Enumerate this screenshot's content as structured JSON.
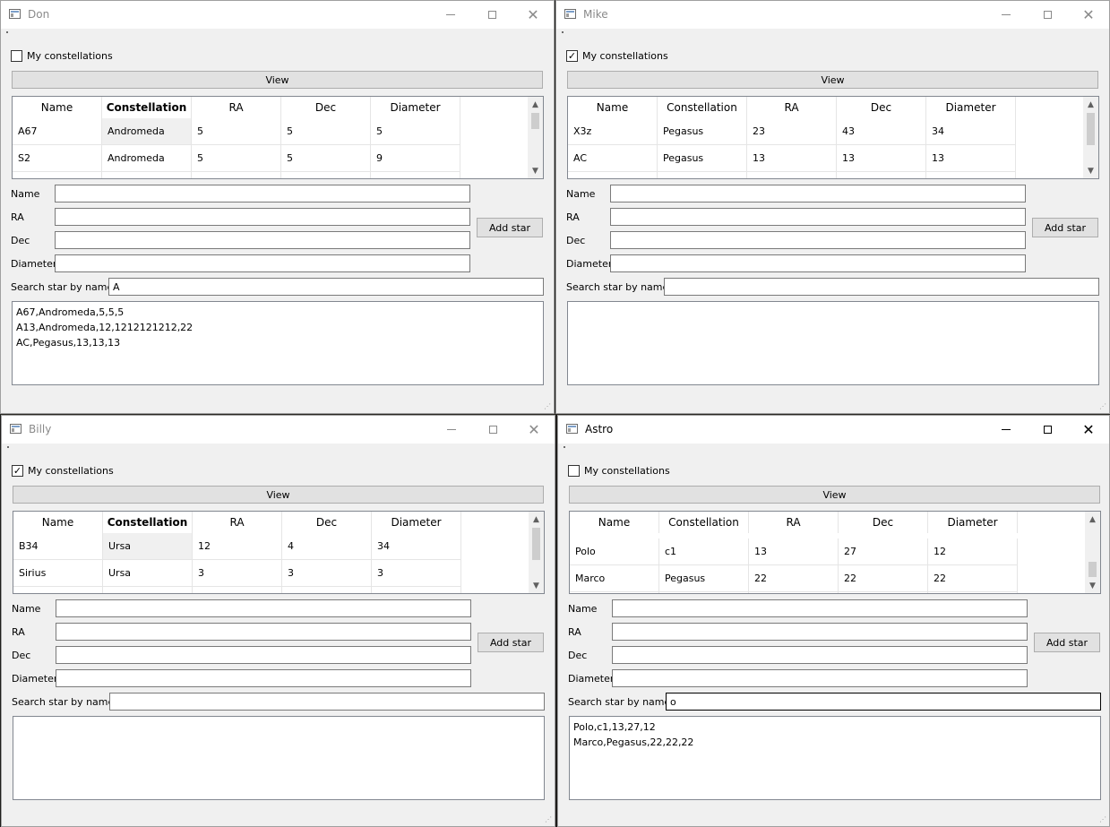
{
  "common": {
    "checkbox_label": "My constellations",
    "view_label": "View",
    "add_star_label": "Add star",
    "search_label": "Search star by name:",
    "field_labels": [
      "Name",
      "RA",
      "Dec",
      "Diameter"
    ],
    "columns": [
      "Name",
      "Constellation",
      "RA",
      "Dec",
      "Diameter"
    ],
    "icons": {
      "minimize": "minimize-icon",
      "maximize": "maximize-icon",
      "close": "close-icon",
      "app": "app-icon"
    }
  },
  "windows": [
    {
      "title": "Don",
      "checked": false,
      "rows": [
        [
          "A67",
          "Andromeda",
          "5",
          "5",
          "5"
        ],
        [
          "S2",
          "Andromeda",
          "5",
          "5",
          "9"
        ]
      ],
      "search_value": "A",
      "results": [
        "A67,Andromeda,5,5,5",
        "A13,Andromeda,12,1212121212,22",
        "AC,Pegasus,13,13,13"
      ]
    },
    {
      "title": "Mike",
      "checked": true,
      "rows": [
        [
          "X3z",
          "Pegasus",
          "23",
          "43",
          "34"
        ],
        [
          "AC",
          "Pegasus",
          "13",
          "13",
          "13"
        ]
      ],
      "search_value": "",
      "results": []
    },
    {
      "title": "Billy",
      "checked": true,
      "rows": [
        [
          "B34",
          "Ursa",
          "12",
          "4",
          "34"
        ],
        [
          "Sirius",
          "Ursa",
          "3",
          "3",
          "3"
        ]
      ],
      "search_value": "",
      "results": []
    },
    {
      "title": "Astro",
      "checked": false,
      "rows": [
        [
          "Polo",
          "c1",
          "13",
          "27",
          "12"
        ],
        [
          "Marco",
          "Pegasus",
          "22",
          "22",
          "22"
        ]
      ],
      "search_value": "o",
      "results": [
        "Polo,c1,13,27,12",
        "Marco,Pegasus,22,22,22"
      ]
    }
  ]
}
